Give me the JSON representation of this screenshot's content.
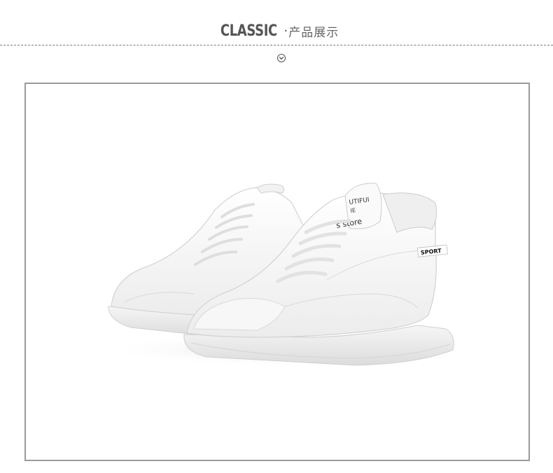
{
  "header": {
    "title_en": "CLASSIC",
    "separator": "·",
    "title_cn": "产品展示"
  },
  "icons": {
    "chevron": "chevron-down-circle-icon"
  },
  "product": {
    "tongue_label_line1": "UTIFUI",
    "tongue_label_line2": "IE",
    "tongue_label_line3": "s store",
    "side_badge": "SPORT"
  }
}
